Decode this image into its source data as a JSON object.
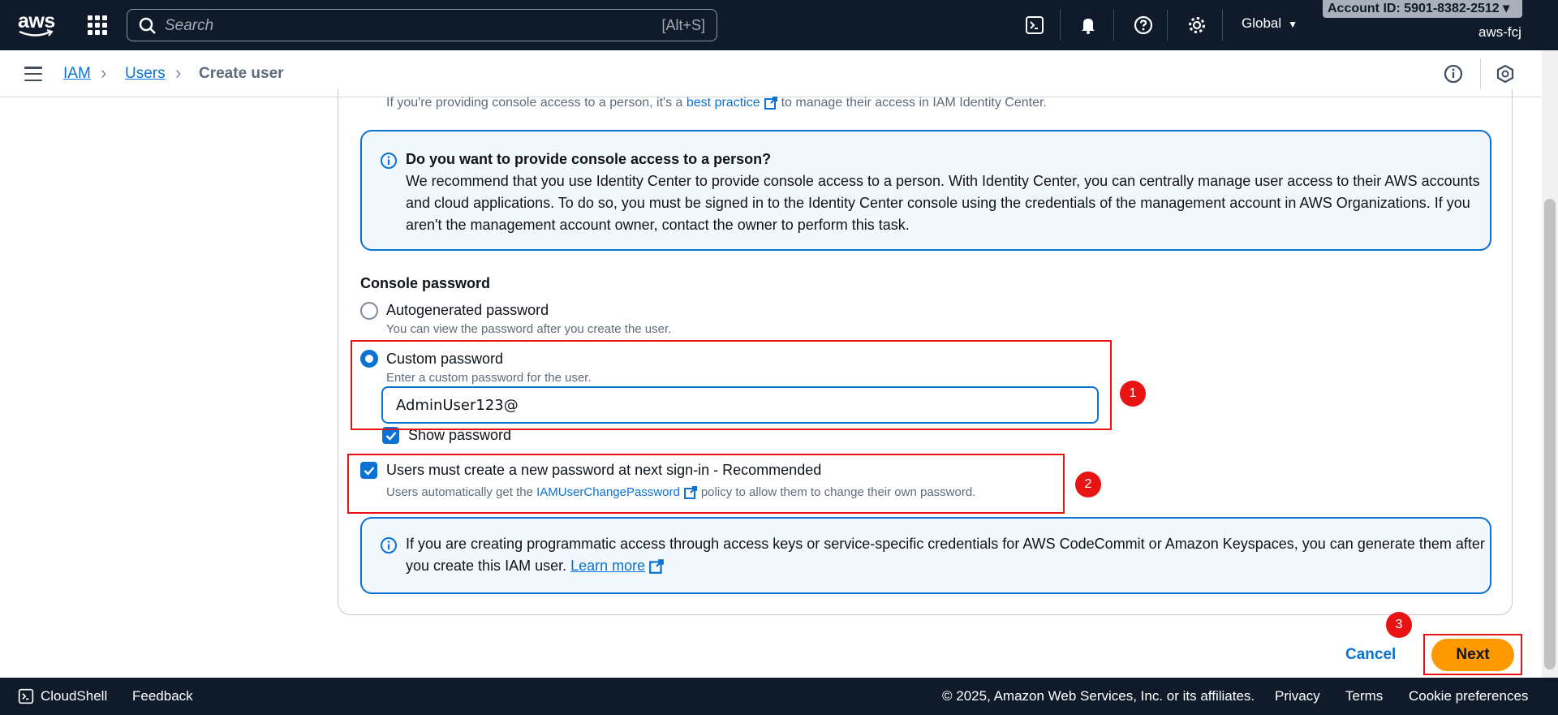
{
  "topnav": {
    "logo_text": "aws",
    "search_placeholder": "Search",
    "search_shortcut": "[Alt+S]",
    "region": "Global",
    "account_id": "Account ID: 5901-8382-2512 ▾",
    "account_name": "aws-fcj"
  },
  "breadcrumb": {
    "items": [
      "IAM",
      "Users",
      "Create user"
    ]
  },
  "intro": {
    "text_before": "If you're providing console access to a person, it's a",
    "link": "best practice",
    "text_after": "to manage their access in IAM Identity Center."
  },
  "info_console": {
    "title": "Do you want to provide console access to a person?",
    "body": "We recommend that you use Identity Center to provide console access to a person. With Identity Center, you can centrally manage user access to their AWS accounts and cloud applications. To do so, you must be signed in to the Identity Center console using the credentials of the management account in AWS Organizations. If you aren't the management account owner, contact the owner to perform this task."
  },
  "console_password": {
    "label": "Console password",
    "autogen_label": "Autogenerated password",
    "autogen_desc": "You can view the password after you create the user.",
    "custom_label": "Custom password",
    "custom_desc": "Enter a custom password for the user.",
    "password_value": "AdminUser123@",
    "show_password_label": "Show password",
    "reset_label": "Users must create a new password at next sign-in - Recommended",
    "reset_desc_before": "Users automatically get the",
    "reset_desc_link": "IAMUserChangePassword",
    "reset_desc_after": "policy to allow them to change their own password."
  },
  "info_programmatic": {
    "body": "If you are creating programmatic access through access keys or service-specific credentials for AWS CodeCommit or Amazon Keyspaces, you can generate them after you create this IAM user.",
    "link": "Learn more"
  },
  "annotations": [
    "1",
    "2",
    "3"
  ],
  "actions": {
    "cancel": "Cancel",
    "next": "Next"
  },
  "footer": {
    "cloudshell": "CloudShell",
    "feedback": "Feedback",
    "copyright": "© 2025, Amazon Web Services, Inc. or its affiliates.",
    "privacy": "Privacy",
    "terms": "Terms",
    "cookies": "Cookie preferences"
  },
  "colors": {
    "nav_bg": "#0f1b2a",
    "link": "#0972d3",
    "primary_button": "#ff9900",
    "annotation_red": "#e81414",
    "info_bg": "#f2f8fd"
  }
}
